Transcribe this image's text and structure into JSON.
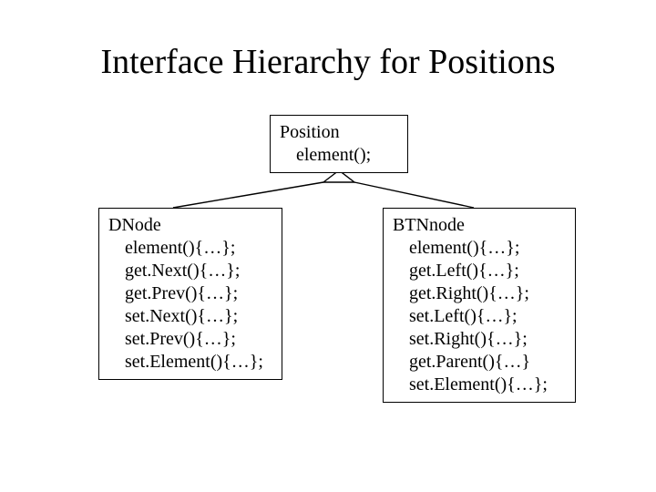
{
  "title": "Interface Hierarchy for Positions",
  "position": {
    "name": "Position",
    "methods": [
      "element();"
    ]
  },
  "dnode": {
    "name": "DNode",
    "methods": [
      "element(){…};",
      "get.Next(){…};",
      "get.Prev(){…};",
      "set.Next(){…};",
      "set.Prev(){…};",
      "set.Element(){…};"
    ]
  },
  "btnnode": {
    "name": "BTNnode",
    "methods": [
      "element(){…};",
      "get.Left(){…};",
      "get.Right(){…};",
      "set.Left(){…};",
      "set.Right(){…};",
      "get.Parent(){…}",
      "set.Element(){…};"
    ]
  }
}
